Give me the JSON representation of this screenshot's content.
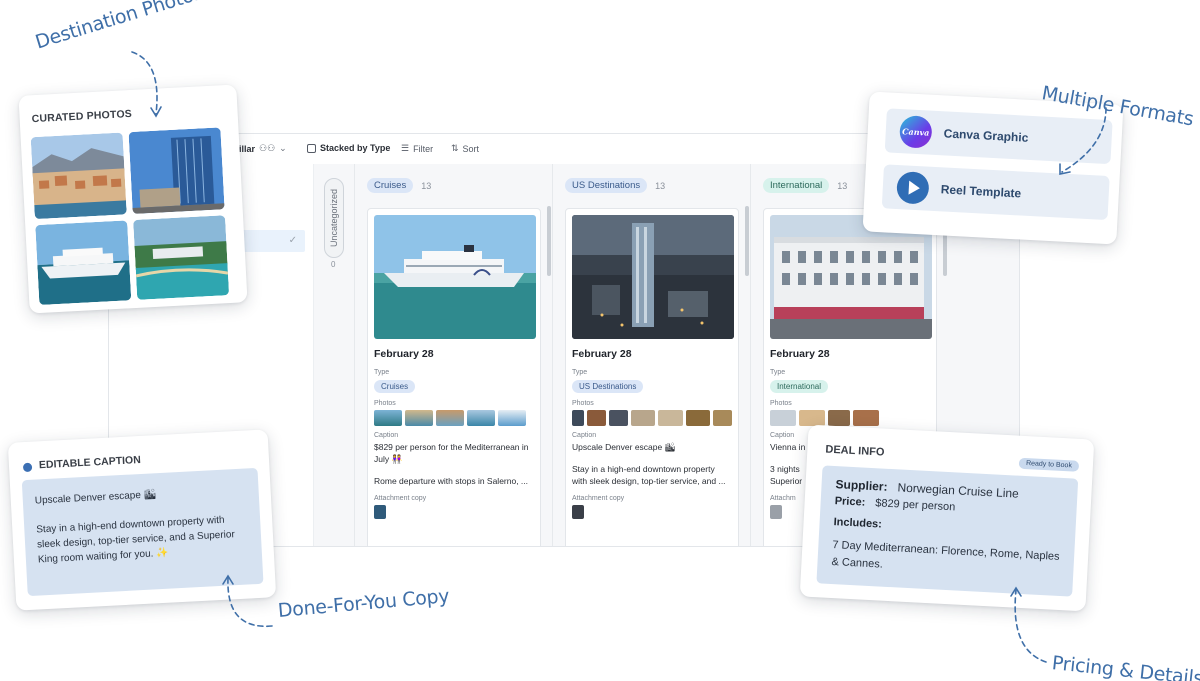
{
  "toolbar": {
    "view_name": "Pillar",
    "people_icon": "people-icon",
    "stacked_label": "Stacked by Type",
    "filter_label": "Filter",
    "sort_label": "Sort"
  },
  "board": {
    "uncategorized": {
      "label": "Uncategorized",
      "count": "0"
    },
    "columns": [
      {
        "name": "Cruises",
        "count": "13",
        "pill_bg": "#dbe6f7",
        "pill_fg": "#3a5a8a",
        "card": {
          "date": "February 28",
          "type_label": "Type",
          "type_value": "Cruises",
          "photos_label": "Photos",
          "caption_label": "Caption",
          "caption_line1": "$829 per person for the Mediterranean in July 👭",
          "caption_line2": "Rome departure with stops in Salerno, ...",
          "attachment_label": "Attachment copy"
        }
      },
      {
        "name": "US Destinations",
        "count": "13",
        "pill_bg": "#dbe6f7",
        "pill_fg": "#3a5a8a",
        "card": {
          "date": "February 28",
          "type_label": "Type",
          "type_value": "US Destinations",
          "photos_label": "Photos",
          "caption_label": "Caption",
          "caption_line1": "Upscale Denver escape 🏙",
          "caption_line2": "Stay in a high-end downtown property with sleek design, top-tier service, and ...",
          "attachment_label": "Attachment copy"
        }
      },
      {
        "name": "International",
        "count": "13",
        "pill_bg": "#d7f2ec",
        "pill_fg": "#2d6a5c",
        "card": {
          "date": "February 28",
          "type_label": "Type",
          "type_value": "International",
          "photos_label": "Photos",
          "caption_label": "Caption",
          "caption_line1": "Vienna in",
          "caption_line2": "3 nights Superior",
          "attachment_label": "Attachm"
        }
      }
    ]
  },
  "photos_card": {
    "title": "CURATED PHOTOS"
  },
  "formats_card": {
    "canva_label": "Canva Graphic",
    "canva_logo": "Canva",
    "reel_label": "Reel Template"
  },
  "caption_card": {
    "title": "EDITABLE CAPTION",
    "line1": "Upscale Denver escape 🏙",
    "line2": "Stay in a high-end downtown property with sleek design, top-tier service, and a Superior King room waiting for you. ✨"
  },
  "deal_card": {
    "title": "DEAL INFO",
    "badge": "Ready to Book",
    "supplier_label": "Supplier:",
    "supplier_value": "Norwegian Cruise Line",
    "price_label": "Price:",
    "price_value": "$829 per person",
    "includes_label": "Includes:",
    "includes_value": "7 Day Mediterranean: Florence, Rome, Naples & Cannes."
  },
  "annotations": {
    "destination_photos": "Destination Photos",
    "multiple_formats": "Multiple Formats",
    "done_for_you": "Done-For-You Copy",
    "pricing_details": "Pricing & Details"
  },
  "colors": {
    "accent": "#3f6fa8",
    "card_fill": "#d6e2f1"
  }
}
